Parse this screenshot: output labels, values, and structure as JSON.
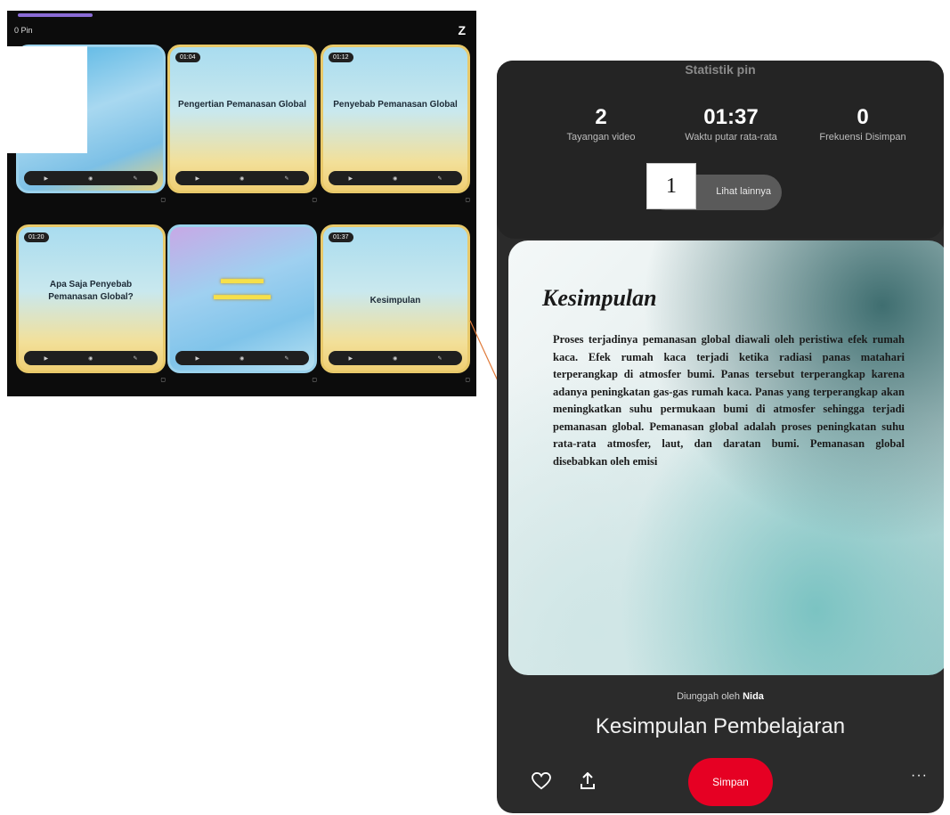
{
  "board": {
    "top_left_text": "0 Pin",
    "corner_icon": "Z",
    "pins": [
      {
        "duration": "",
        "title": "",
        "caption": "",
        "stats": [
          "",
          "",
          ""
        ]
      },
      {
        "duration": "01:04",
        "title": "Pengertian Pemanasan Global",
        "caption": "",
        "stats": [
          "",
          "",
          ""
        ]
      },
      {
        "duration": "01:12",
        "title": "Penyebab Pemanasan Global",
        "caption": "",
        "stats": [
          "",
          "",
          ""
        ]
      },
      {
        "duration": "01:20",
        "title": "Apa Saja Penyebab Pemanasan Global?",
        "caption": "",
        "stats": [
          "",
          "",
          ""
        ]
      },
      {
        "duration": "",
        "title": "",
        "caption": "",
        "stats": [
          "",
          "",
          ""
        ]
      },
      {
        "duration": "01:37",
        "title": "Kesimpulan",
        "caption": "",
        "stats": [
          "",
          "",
          ""
        ]
      }
    ]
  },
  "detail": {
    "stats_title": "Statistik pin",
    "stats_subtitle": "",
    "stats": [
      {
        "value": "2",
        "label": "Tayangan video"
      },
      {
        "value": "01:37",
        "label": "Waktu putar rata-rata"
      },
      {
        "value": "0",
        "label": "Frekuensi Disimpan"
      }
    ],
    "more_button": "Lihat lainnya",
    "marker_label": "1",
    "card_heading": "Kesimpulan",
    "card_body": "Proses terjadinya pemanasan global diawali oleh peristiwa efek rumah kaca. Efek rumah kaca terjadi ketika radiasi panas matahari terperangkap di atmosfer bumi. Panas tersebut terperangkap karena adanya peningkatan gas-gas rumah kaca. Panas yang terperangkap akan meningkatkan suhu permukaan bumi di atmosfer sehingga terjadi pemanasan global. Pemanasan global adalah proses peningkatan suhu rata-rata atmosfer, laut, dan daratan bumi. Pemanasan global disebabkan oleh emisi",
    "uploader_prefix": "Diunggah oleh",
    "uploader_name": "Nida",
    "pin_title": "Kesimpulan Pembelajaran",
    "save_button": "Simpan",
    "more_icon": "···",
    "heart_icon": "heart-icon",
    "share_icon": "share-icon"
  },
  "colors": {
    "save_red": "#e60023",
    "connector": "#e07a3a",
    "progress": "#8a6bd6"
  }
}
